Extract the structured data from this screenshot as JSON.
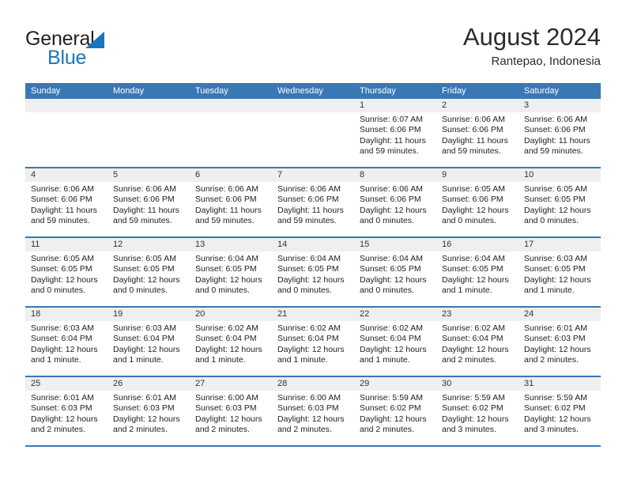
{
  "brand": {
    "name_part1": "General",
    "name_part2": "Blue",
    "triangle_color": "#1b75bb"
  },
  "header": {
    "title": "August 2024",
    "subtitle": "Rantepao, Indonesia"
  },
  "theme": {
    "header_blue": "#3a78b5",
    "day_band_gray": "#efefef",
    "text_color": "#222222"
  },
  "weekdays": [
    "Sunday",
    "Monday",
    "Tuesday",
    "Wednesday",
    "Thursday",
    "Friday",
    "Saturday"
  ],
  "labels": {
    "sunrise_prefix": "Sunrise: ",
    "sunset_prefix": "Sunset: ",
    "daylight_prefix": "Daylight: "
  },
  "weeks": [
    [
      {
        "day": "",
        "empty": true
      },
      {
        "day": "",
        "empty": true
      },
      {
        "day": "",
        "empty": true
      },
      {
        "day": "",
        "empty": true
      },
      {
        "day": "1",
        "sunrise": "Sunrise: 6:07 AM",
        "sunset": "Sunset: 6:06 PM",
        "daylight": "Daylight: 11 hours and 59 minutes."
      },
      {
        "day": "2",
        "sunrise": "Sunrise: 6:06 AM",
        "sunset": "Sunset: 6:06 PM",
        "daylight": "Daylight: 11 hours and 59 minutes."
      },
      {
        "day": "3",
        "sunrise": "Sunrise: 6:06 AM",
        "sunset": "Sunset: 6:06 PM",
        "daylight": "Daylight: 11 hours and 59 minutes."
      }
    ],
    [
      {
        "day": "4",
        "sunrise": "Sunrise: 6:06 AM",
        "sunset": "Sunset: 6:06 PM",
        "daylight": "Daylight: 11 hours and 59 minutes."
      },
      {
        "day": "5",
        "sunrise": "Sunrise: 6:06 AM",
        "sunset": "Sunset: 6:06 PM",
        "daylight": "Daylight: 11 hours and 59 minutes."
      },
      {
        "day": "6",
        "sunrise": "Sunrise: 6:06 AM",
        "sunset": "Sunset: 6:06 PM",
        "daylight": "Daylight: 11 hours and 59 minutes."
      },
      {
        "day": "7",
        "sunrise": "Sunrise: 6:06 AM",
        "sunset": "Sunset: 6:06 PM",
        "daylight": "Daylight: 11 hours and 59 minutes."
      },
      {
        "day": "8",
        "sunrise": "Sunrise: 6:06 AM",
        "sunset": "Sunset: 6:06 PM",
        "daylight": "Daylight: 12 hours and 0 minutes."
      },
      {
        "day": "9",
        "sunrise": "Sunrise: 6:05 AM",
        "sunset": "Sunset: 6:06 PM",
        "daylight": "Daylight: 12 hours and 0 minutes."
      },
      {
        "day": "10",
        "sunrise": "Sunrise: 6:05 AM",
        "sunset": "Sunset: 6:05 PM",
        "daylight": "Daylight: 12 hours and 0 minutes."
      }
    ],
    [
      {
        "day": "11",
        "sunrise": "Sunrise: 6:05 AM",
        "sunset": "Sunset: 6:05 PM",
        "daylight": "Daylight: 12 hours and 0 minutes."
      },
      {
        "day": "12",
        "sunrise": "Sunrise: 6:05 AM",
        "sunset": "Sunset: 6:05 PM",
        "daylight": "Daylight: 12 hours and 0 minutes."
      },
      {
        "day": "13",
        "sunrise": "Sunrise: 6:04 AM",
        "sunset": "Sunset: 6:05 PM",
        "daylight": "Daylight: 12 hours and 0 minutes."
      },
      {
        "day": "14",
        "sunrise": "Sunrise: 6:04 AM",
        "sunset": "Sunset: 6:05 PM",
        "daylight": "Daylight: 12 hours and 0 minutes."
      },
      {
        "day": "15",
        "sunrise": "Sunrise: 6:04 AM",
        "sunset": "Sunset: 6:05 PM",
        "daylight": "Daylight: 12 hours and 0 minutes."
      },
      {
        "day": "16",
        "sunrise": "Sunrise: 6:04 AM",
        "sunset": "Sunset: 6:05 PM",
        "daylight": "Daylight: 12 hours and 1 minute."
      },
      {
        "day": "17",
        "sunrise": "Sunrise: 6:03 AM",
        "sunset": "Sunset: 6:05 PM",
        "daylight": "Daylight: 12 hours and 1 minute."
      }
    ],
    [
      {
        "day": "18",
        "sunrise": "Sunrise: 6:03 AM",
        "sunset": "Sunset: 6:04 PM",
        "daylight": "Daylight: 12 hours and 1 minute."
      },
      {
        "day": "19",
        "sunrise": "Sunrise: 6:03 AM",
        "sunset": "Sunset: 6:04 PM",
        "daylight": "Daylight: 12 hours and 1 minute."
      },
      {
        "day": "20",
        "sunrise": "Sunrise: 6:02 AM",
        "sunset": "Sunset: 6:04 PM",
        "daylight": "Daylight: 12 hours and 1 minute."
      },
      {
        "day": "21",
        "sunrise": "Sunrise: 6:02 AM",
        "sunset": "Sunset: 6:04 PM",
        "daylight": "Daylight: 12 hours and 1 minute."
      },
      {
        "day": "22",
        "sunrise": "Sunrise: 6:02 AM",
        "sunset": "Sunset: 6:04 PM",
        "daylight": "Daylight: 12 hours and 1 minute."
      },
      {
        "day": "23",
        "sunrise": "Sunrise: 6:02 AM",
        "sunset": "Sunset: 6:04 PM",
        "daylight": "Daylight: 12 hours and 2 minutes."
      },
      {
        "day": "24",
        "sunrise": "Sunrise: 6:01 AM",
        "sunset": "Sunset: 6:03 PM",
        "daylight": "Daylight: 12 hours and 2 minutes."
      }
    ],
    [
      {
        "day": "25",
        "sunrise": "Sunrise: 6:01 AM",
        "sunset": "Sunset: 6:03 PM",
        "daylight": "Daylight: 12 hours and 2 minutes."
      },
      {
        "day": "26",
        "sunrise": "Sunrise: 6:01 AM",
        "sunset": "Sunset: 6:03 PM",
        "daylight": "Daylight: 12 hours and 2 minutes."
      },
      {
        "day": "27",
        "sunrise": "Sunrise: 6:00 AM",
        "sunset": "Sunset: 6:03 PM",
        "daylight": "Daylight: 12 hours and 2 minutes."
      },
      {
        "day": "28",
        "sunrise": "Sunrise: 6:00 AM",
        "sunset": "Sunset: 6:03 PM",
        "daylight": "Daylight: 12 hours and 2 minutes."
      },
      {
        "day": "29",
        "sunrise": "Sunrise: 5:59 AM",
        "sunset": "Sunset: 6:02 PM",
        "daylight": "Daylight: 12 hours and 2 minutes."
      },
      {
        "day": "30",
        "sunrise": "Sunrise: 5:59 AM",
        "sunset": "Sunset: 6:02 PM",
        "daylight": "Daylight: 12 hours and 3 minutes."
      },
      {
        "day": "31",
        "sunrise": "Sunrise: 5:59 AM",
        "sunset": "Sunset: 6:02 PM",
        "daylight": "Daylight: 12 hours and 3 minutes."
      }
    ]
  ]
}
